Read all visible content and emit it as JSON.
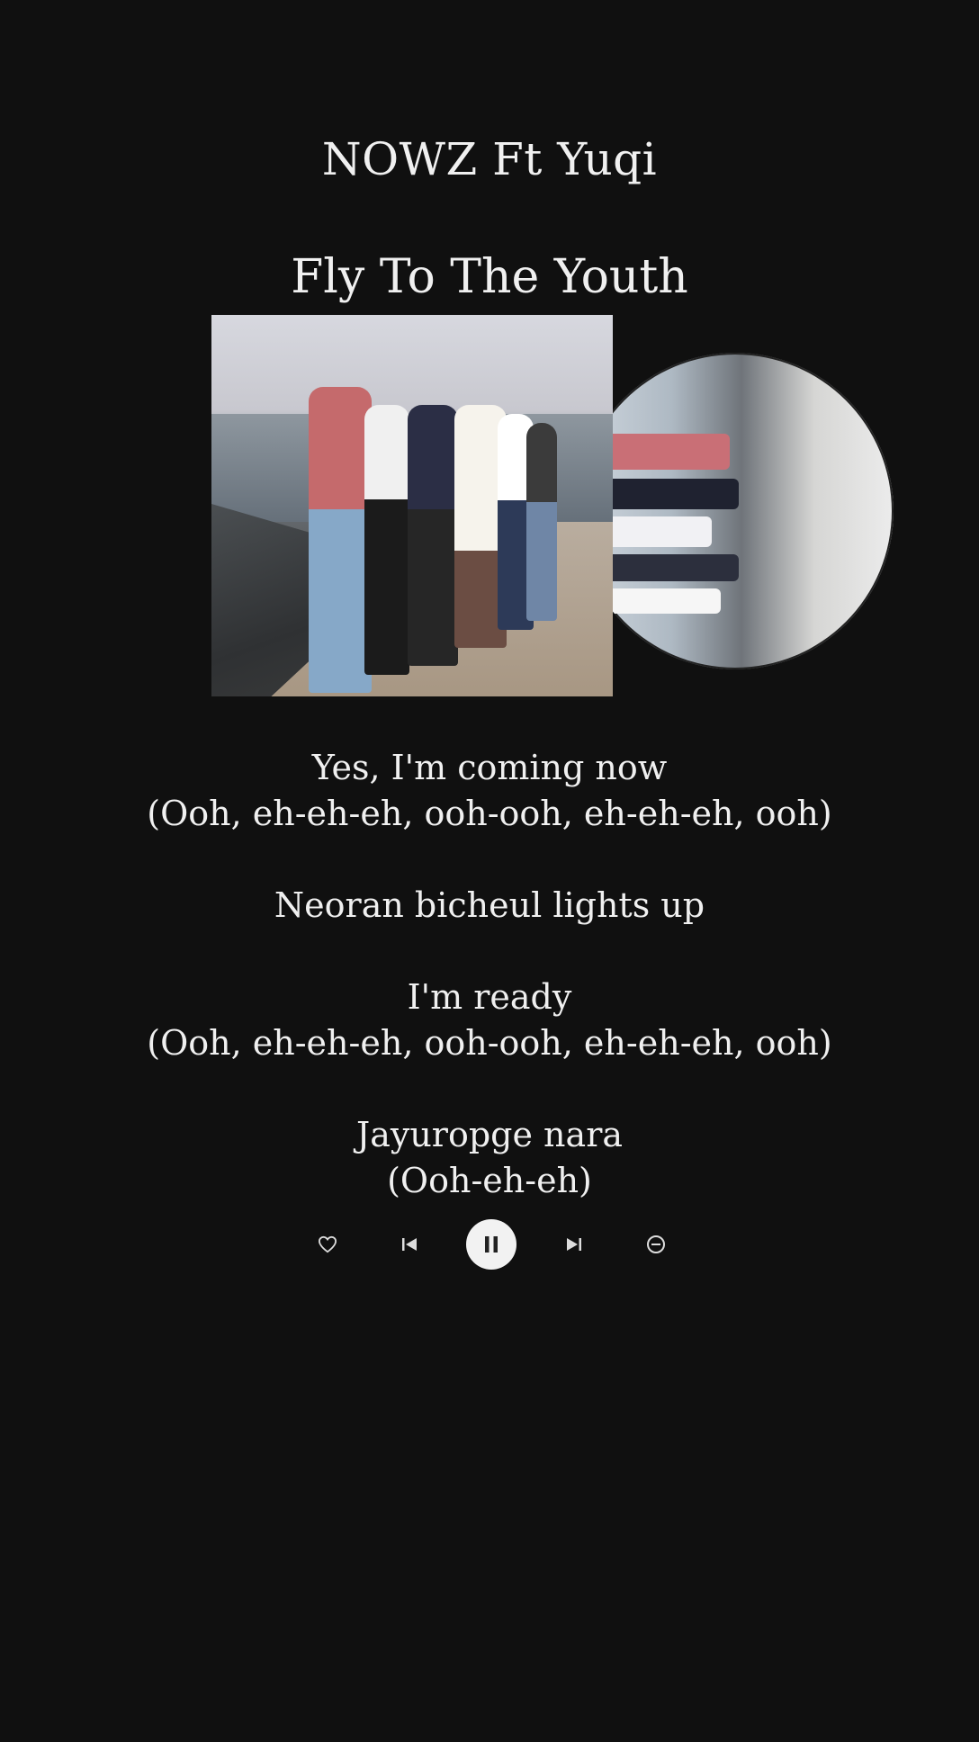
{
  "artist": "NOWZ Ft Yuqi",
  "title": "Fly To The Youth",
  "lyrics": [
    [
      "Yes, I'm coming now",
      "(Ooh, eh-eh-eh, ooh-ooh, eh-eh-eh, ooh)"
    ],
    [
      "Neoran bicheul lights up"
    ],
    [
      "I'm ready",
      "(Ooh, eh-eh-eh, ooh-ooh, eh-eh-eh, ooh)"
    ],
    [
      "Jayuropge nara",
      "(Ooh-eh-eh)"
    ]
  ],
  "controls": {
    "like": "heart-icon",
    "previous": "skip-previous-icon",
    "play_pause": "pause-icon",
    "next": "skip-next-icon",
    "remove": "minus-circle-icon"
  },
  "colors": {
    "background": "#101010",
    "text": "#f0f0f0",
    "play_button": "#f2f2f2"
  }
}
